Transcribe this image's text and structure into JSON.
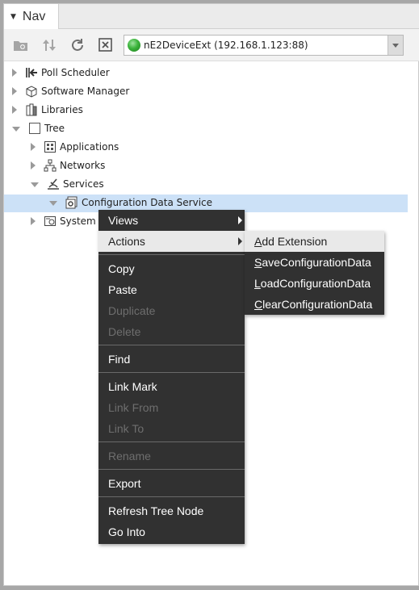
{
  "tab": {
    "title": "Nav"
  },
  "toolbar": {
    "station": "nE2DeviceExt (192.168.1.123:88)",
    "buttons": [
      "new-folder-icon",
      "sort-icon",
      "refresh-icon",
      "close-icon"
    ]
  },
  "tree": {
    "poll_scheduler": "Poll Scheduler",
    "software_manager": "Software Manager",
    "libraries": "Libraries",
    "tree": "Tree",
    "applications": "Applications",
    "networks": "Networks",
    "services": "Services",
    "config_service": "Configuration Data Service",
    "system": "System"
  },
  "context_menu": {
    "views": "Views",
    "actions": "Actions",
    "copy": "Copy",
    "paste": "Paste",
    "duplicate": "Duplicate",
    "delete": "Delete",
    "find": "Find",
    "link_mark": "Link Mark",
    "link_from": "Link From",
    "link_to": "Link To",
    "rename": "Rename",
    "export": "Export",
    "refresh_tree_node": "Refresh Tree Node",
    "go_into": "Go Into"
  },
  "submenu": {
    "add_extension": {
      "first": "A",
      "rest": "dd Extension"
    },
    "save": {
      "first": "S",
      "rest": "aveConfigurationData"
    },
    "load": {
      "first": "L",
      "rest": "oadConfigurationData"
    },
    "clear": {
      "first": "C",
      "rest": "learConfigurationData"
    }
  }
}
